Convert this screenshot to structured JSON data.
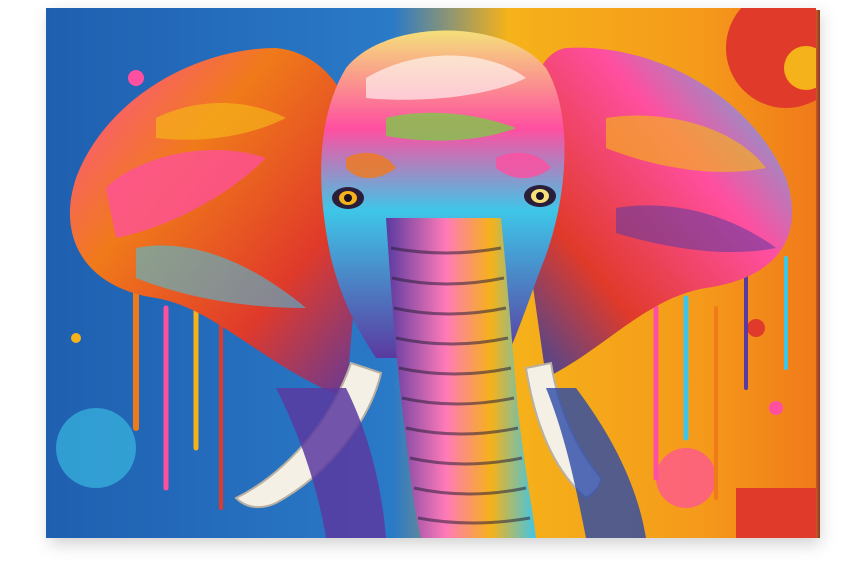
{
  "artwork": {
    "subject": "elephant-pop-art-canvas",
    "palette": {
      "bg_blue": "#1f5fb0",
      "bg_yellow": "#f5b21a",
      "bg_orange": "#f07a1a",
      "bg_red": "#e03a2a",
      "pink": "#ff4fa0",
      "cyan": "#3ec6e8",
      "purple": "#5a3aa0",
      "green": "#7fc84a",
      "tusk": "#f4f0e6",
      "dark": "#2a1e3a"
    }
  }
}
